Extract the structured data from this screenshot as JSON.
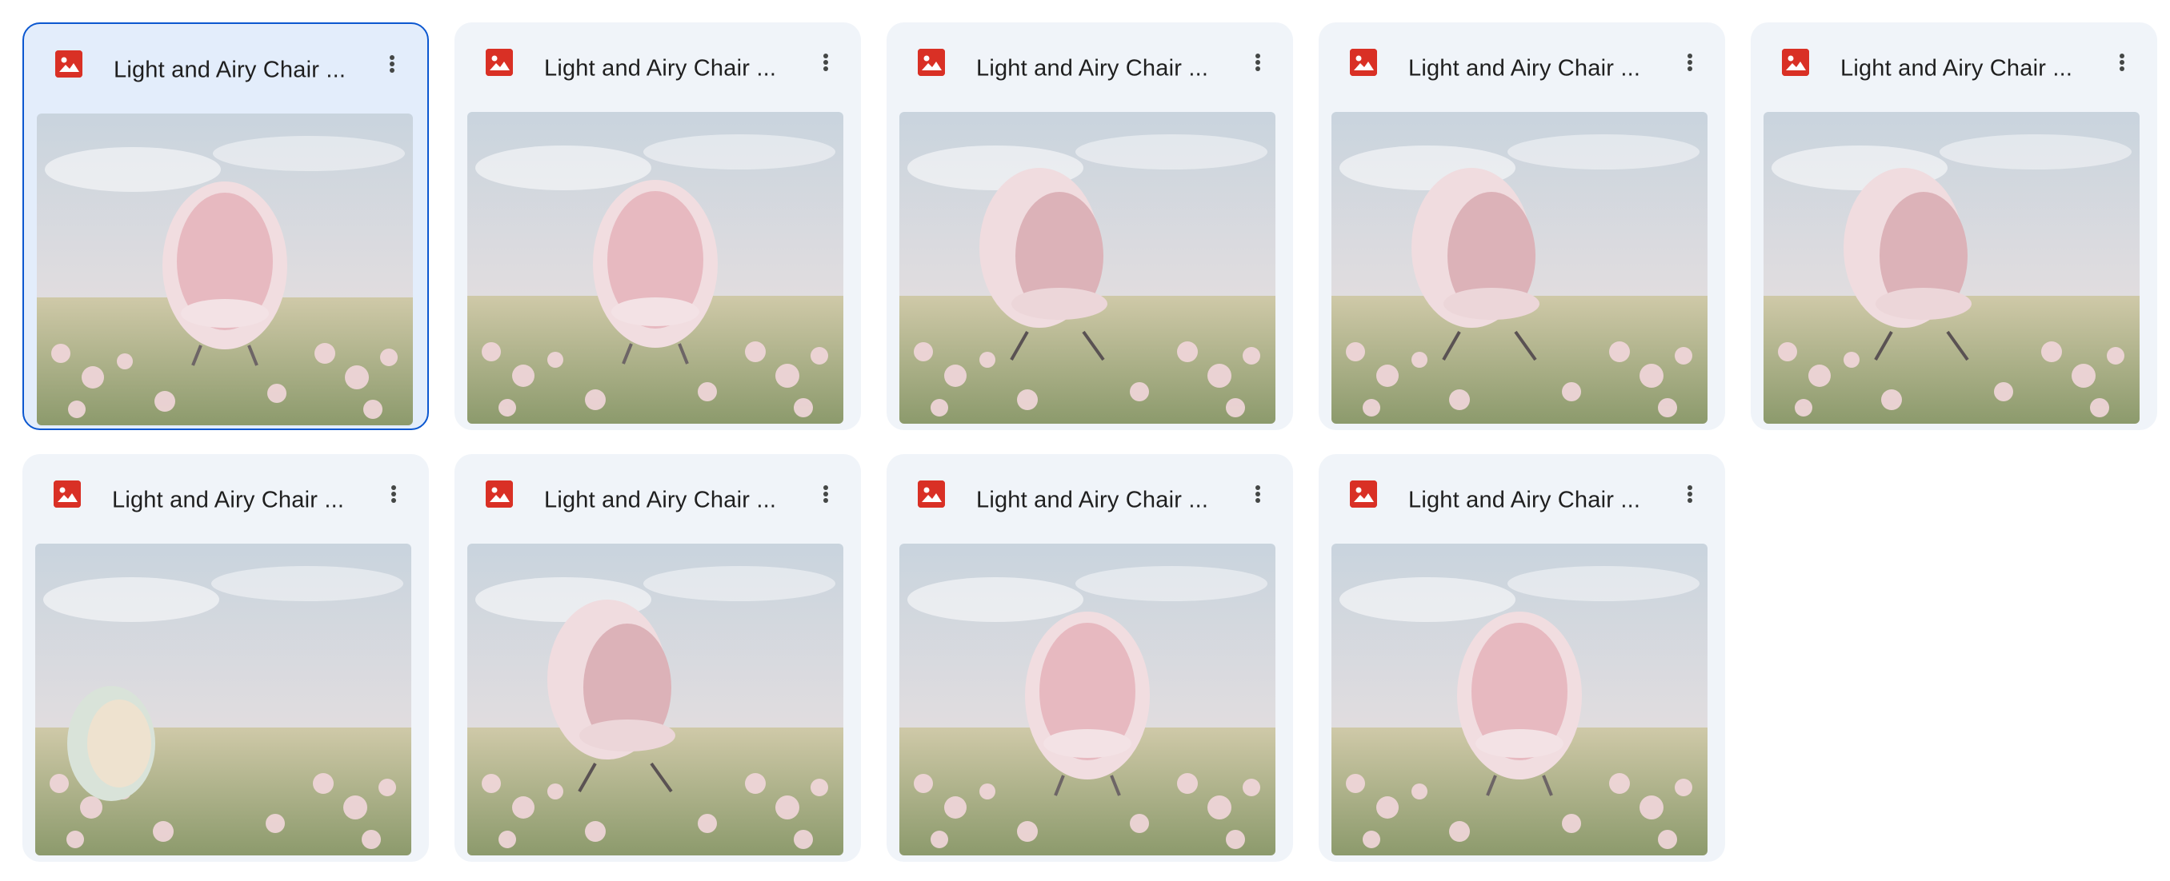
{
  "files": [
    {
      "title": "Light and Airy Chair ...",
      "icon": "image-file-icon",
      "selected": true,
      "variant": "front"
    },
    {
      "title": "Light and Airy Chair ...",
      "icon": "image-file-icon",
      "selected": false,
      "variant": "front"
    },
    {
      "title": "Light and Airy Chair ...",
      "icon": "image-file-icon",
      "selected": false,
      "variant": "side"
    },
    {
      "title": "Light and Airy Chair ...",
      "icon": "image-file-icon",
      "selected": false,
      "variant": "side"
    },
    {
      "title": "Light and Airy Chair ...",
      "icon": "image-file-icon",
      "selected": false,
      "variant": "side"
    },
    {
      "title": "Light and Airy Chair ...",
      "icon": "image-file-icon",
      "selected": false,
      "variant": "small"
    },
    {
      "title": "Light and Airy Chair ...",
      "icon": "image-file-icon",
      "selected": false,
      "variant": "side"
    },
    {
      "title": "Light and Airy Chair ...",
      "icon": "image-file-icon",
      "selected": false,
      "variant": "front"
    },
    {
      "title": "Light and Airy Chair ...",
      "icon": "image-file-icon",
      "selected": false,
      "variant": "front"
    }
  ],
  "colors": {
    "card_bg": "#f0f4f9",
    "selected_border": "#0b57d0",
    "file_icon": "#d93025"
  }
}
